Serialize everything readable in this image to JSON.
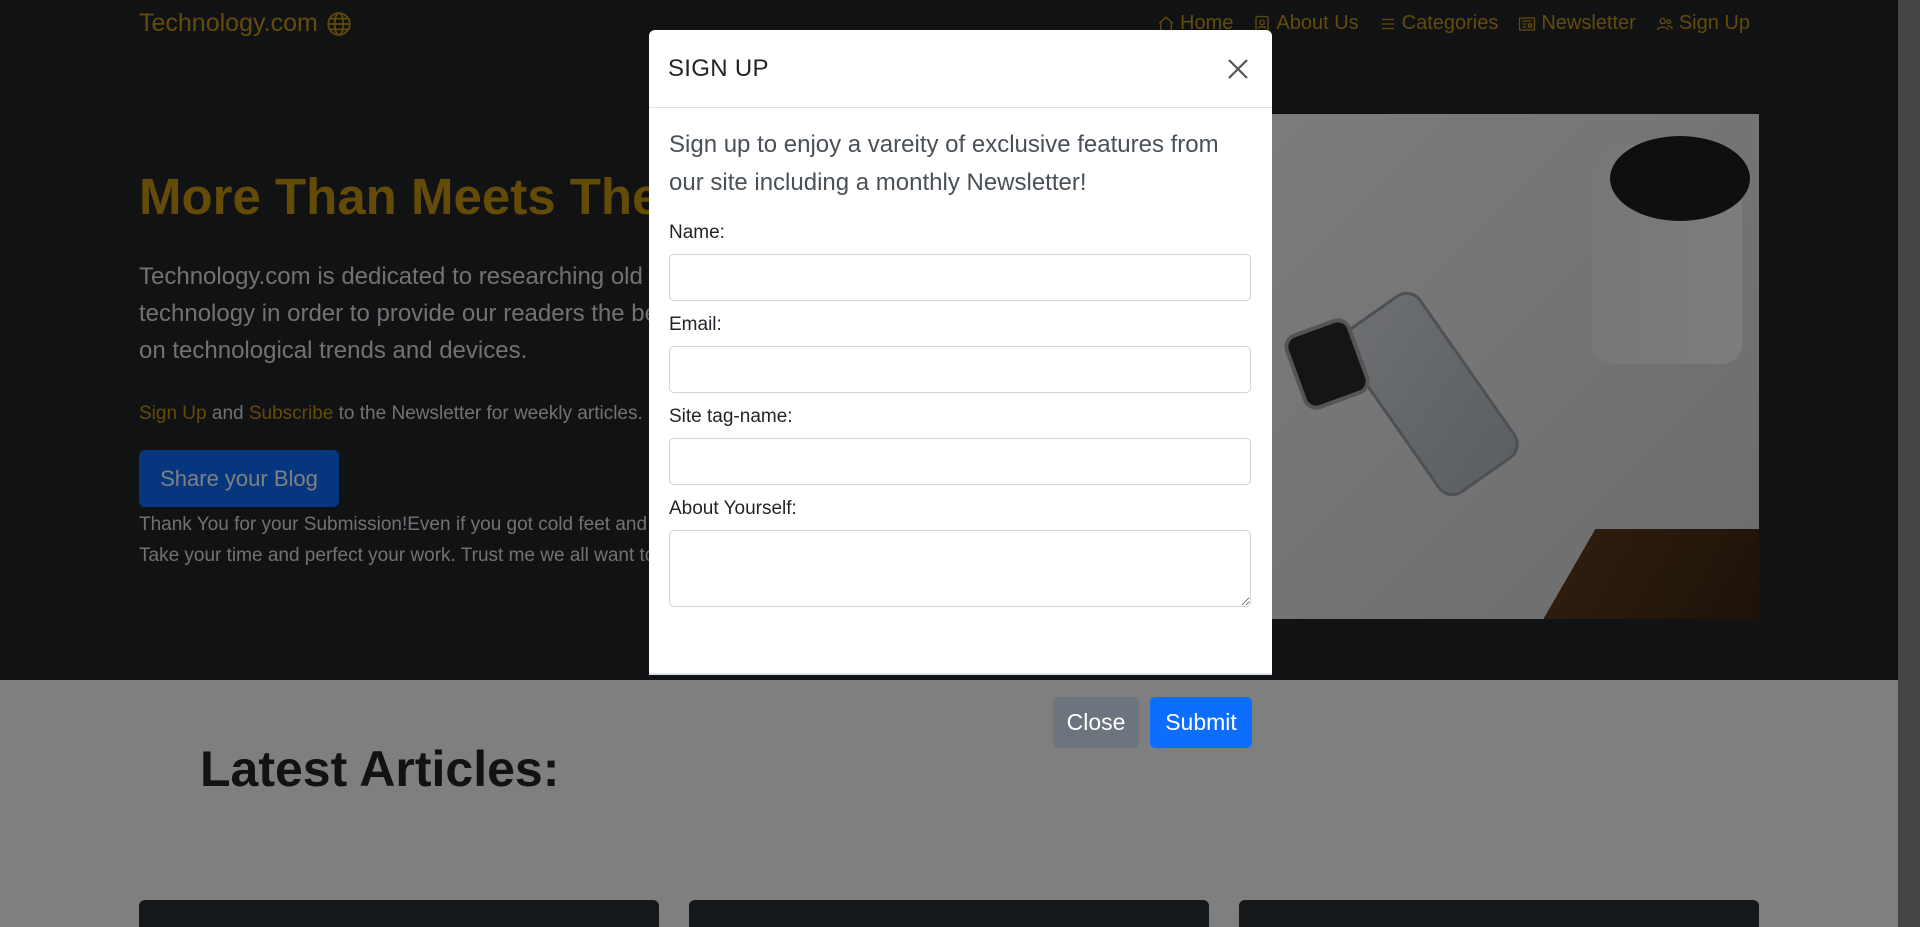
{
  "site": {
    "brand": "Technology.com",
    "nav": [
      {
        "label": "Home",
        "icon": "home-icon"
      },
      {
        "label": "About Us",
        "icon": "person-badge-icon"
      },
      {
        "label": "Categories",
        "icon": "list-icon"
      },
      {
        "label": "Newsletter",
        "icon": "newspaper-icon"
      },
      {
        "label": "Sign Up",
        "icon": "people-icon"
      }
    ],
    "hero": {
      "title": "More Than Meets The Eye",
      "lead": "Technology.com is dedicated to researching old and new technology in order to provide our readers the best insight on technological trends and devices.",
      "signup_link": "Sign Up",
      "and_text": " and ",
      "subscribe_link": "Subscribe",
      "sub_rest": " to the Newsletter for weekly articles.",
      "share_button": "Share your Blog",
      "note_line1": "Thank You for your Submission!Even if you got cold feet and didn't submit.",
      "note_line2": "Take your time and perfect your work. Trust me we all want to read it."
    },
    "latest_heading": "Latest Articles:"
  },
  "modal": {
    "title": "SIGN UP",
    "intro": "Sign up to enjoy a vareity of exclusive features from our site including a monthly Newsletter!",
    "fields": {
      "name_label": "Name:",
      "name_value": "",
      "email_label": "Email:",
      "email_value": "",
      "tag_label": "Site tag-name:",
      "tag_value": "",
      "about_label": "About Yourself:",
      "about_value": ""
    },
    "close_button": "Close",
    "submit_button": "Submit"
  },
  "colors": {
    "accent": "#c9960f",
    "hero_bg": "#212529",
    "primary": "#0d6efd",
    "secondary": "#6c757d"
  }
}
